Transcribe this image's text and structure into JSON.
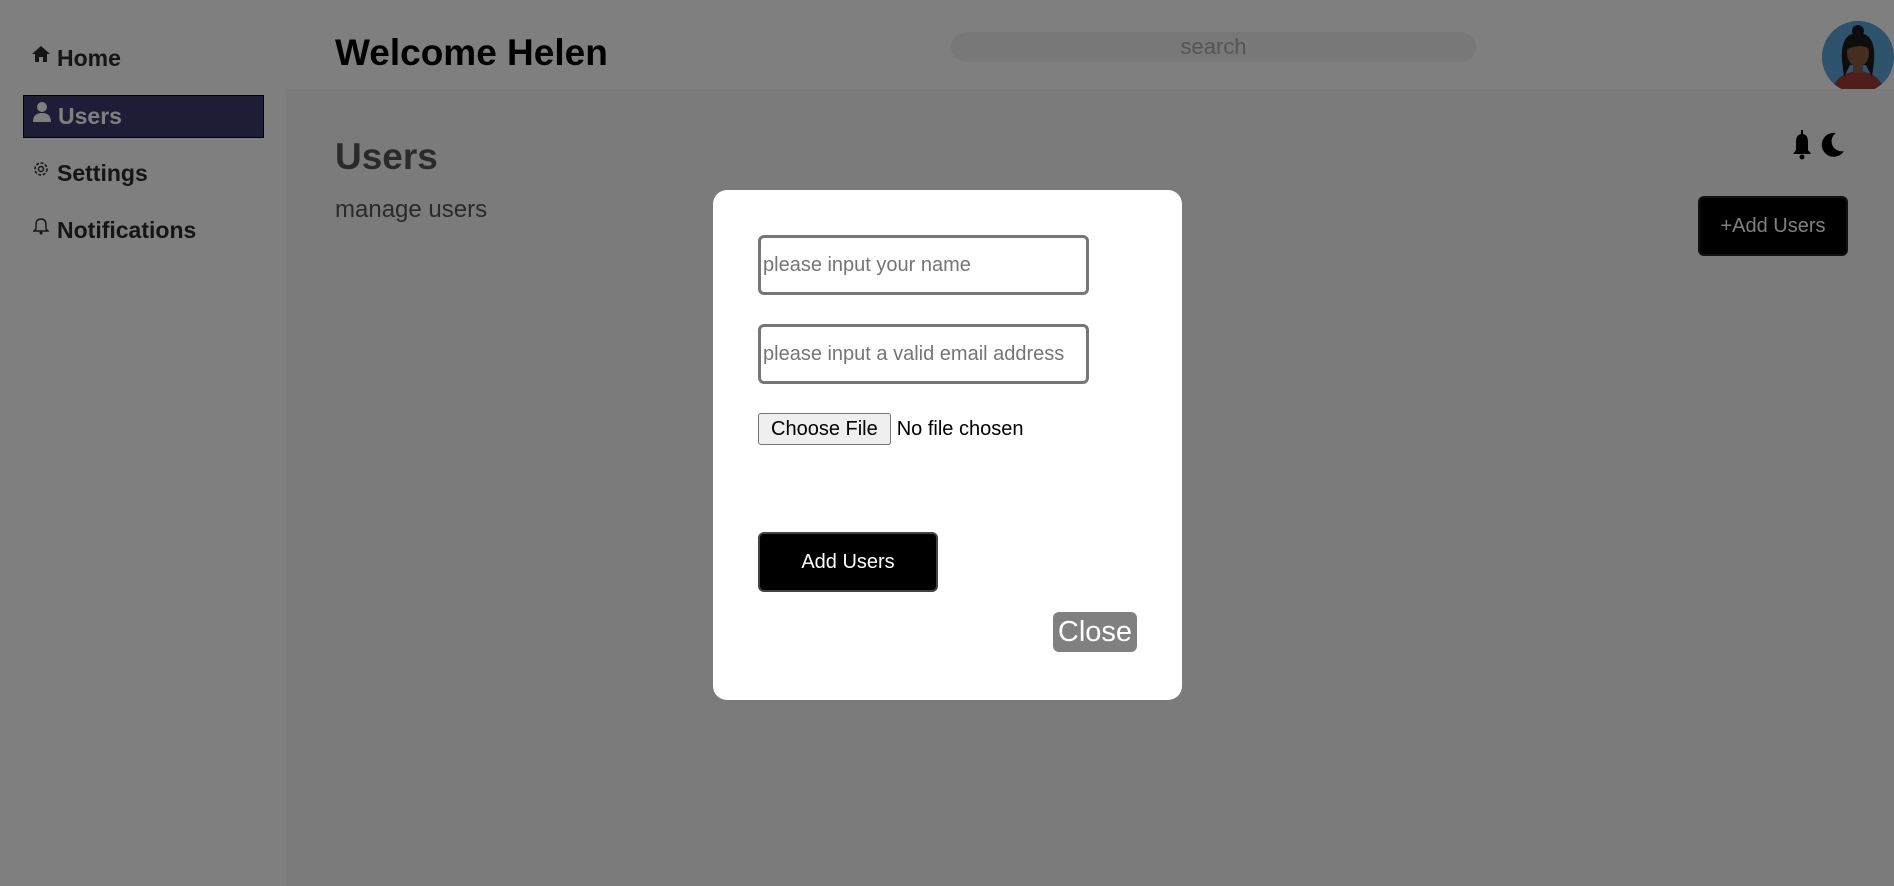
{
  "sidebar": {
    "items": [
      {
        "label": "Home",
        "icon": "home-icon",
        "active": false
      },
      {
        "label": "Users",
        "icon": "user-icon",
        "active": true
      },
      {
        "label": "Settings",
        "icon": "gear-icon",
        "active": false
      },
      {
        "label": "Notifications",
        "icon": "bell-icon",
        "active": false
      }
    ]
  },
  "header": {
    "welcome": "Welcome Helen",
    "search_placeholder": "search",
    "avatar_icon": "user-avatar"
  },
  "page": {
    "title": "Users",
    "subtitle": "manage users",
    "add_button_label": "+Add Users",
    "icons": [
      "bell-icon",
      "moon-icon"
    ]
  },
  "modal": {
    "name_placeholder": "please input your name",
    "email_placeholder": "please input a valid email address",
    "file_button_label": "Choose File",
    "file_status": "No file chosen",
    "submit_label": "Add Users",
    "close_label": "Close"
  },
  "colors": {
    "overlay": "#808080",
    "active_sidebar": "#1f1f2e",
    "button_bg": "#000000",
    "close_bg": "#808080"
  }
}
